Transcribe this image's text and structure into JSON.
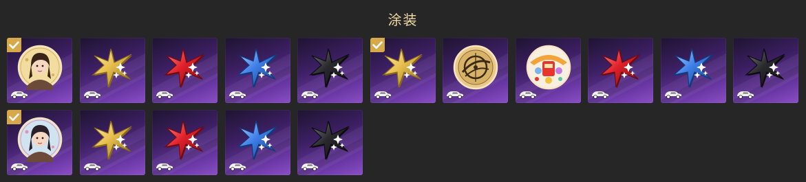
{
  "panel": {
    "title": "涂装"
  },
  "colors": {
    "background": "#262626",
    "title": "#f2dca6",
    "tile_gradient": [
      "#1e1430",
      "#3c1f63",
      "#6b38a6",
      "#8a4fc4"
    ],
    "check_badge": "#d8a94a",
    "gold": "#e8bf4e",
    "red": "#e0202a",
    "blue": "#3f7fe8",
    "black": "#2a2a2e"
  },
  "tiles": [
    {
      "emblem": "portrait-avatar-icon",
      "variant": "portrait-girl",
      "selected": true
    },
    {
      "emblem": "star-emblem-icon",
      "variant": "gold",
      "selected": false
    },
    {
      "emblem": "star-emblem-icon",
      "variant": "red",
      "selected": false
    },
    {
      "emblem": "star-emblem-icon",
      "variant": "blue",
      "selected": false
    },
    {
      "emblem": "star-emblem-icon",
      "variant": "black",
      "selected": false
    },
    {
      "emblem": "star-emblem-icon",
      "variant": "gold",
      "selected": true
    },
    {
      "emblem": "gold-compass-emblem-icon",
      "variant": "gold-coin",
      "selected": false
    },
    {
      "emblem": "festive-badge-icon",
      "variant": "colorful",
      "selected": false
    },
    {
      "emblem": "star-emblem-icon",
      "variant": "red",
      "selected": false
    },
    {
      "emblem": "star-emblem-icon",
      "variant": "blue",
      "selected": false
    },
    {
      "emblem": "star-emblem-icon",
      "variant": "black",
      "selected": false
    },
    {
      "emblem": "portrait-avatar-icon",
      "variant": "portrait-girl-2",
      "selected": true
    },
    {
      "emblem": "star-emblem-icon",
      "variant": "gold",
      "selected": false
    },
    {
      "emblem": "star-emblem-icon",
      "variant": "red",
      "selected": false
    },
    {
      "emblem": "star-emblem-icon",
      "variant": "blue",
      "selected": false
    },
    {
      "emblem": "star-emblem-icon",
      "variant": "black",
      "selected": false
    }
  ],
  "icons": {
    "vehicle": "vehicle-icon",
    "check": "checkmark-icon"
  }
}
